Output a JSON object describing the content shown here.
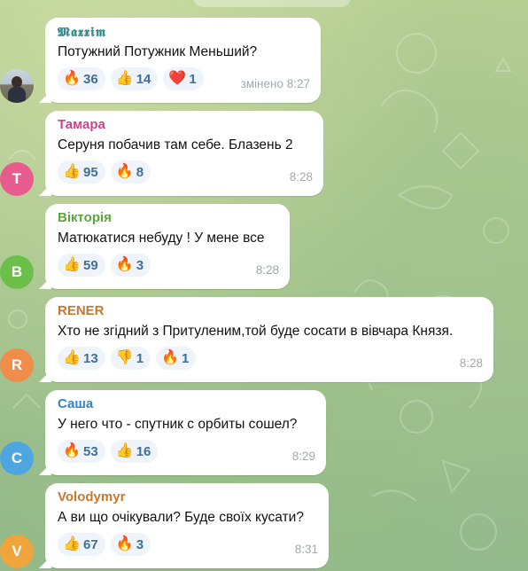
{
  "messages": [
    {
      "sender": "𝕸𝖆𝖝𝖝𝖎𝖒",
      "sender_color": "#3a8a8e",
      "text": "Потужний Потужник Меньший?",
      "reactions": [
        {
          "emoji": "🔥",
          "count": "36"
        },
        {
          "emoji": "👍",
          "count": "14"
        },
        {
          "emoji": "❤️",
          "count": "1"
        }
      ],
      "time": "змінено 8:27",
      "avatar": {
        "type": "photo"
      }
    },
    {
      "sender": "Тамара",
      "sender_color": "#c3468f",
      "text": "Серуня побачив там себе.  Блазень 2",
      "reactions": [
        {
          "emoji": "👍",
          "count": "95"
        },
        {
          "emoji": "🔥",
          "count": "8"
        }
      ],
      "time": "8:28",
      "avatar": {
        "type": "letter",
        "letter": "T",
        "color": "#e85c8d"
      }
    },
    {
      "sender": "Вікторія",
      "sender_color": "#5aa63a",
      "text": "Матюкатися небуду ! У мене все",
      "reactions": [
        {
          "emoji": "👍",
          "count": "59"
        },
        {
          "emoji": "🔥",
          "count": "3"
        }
      ],
      "time": "8:28",
      "avatar": {
        "type": "letter",
        "letter": "B",
        "color": "#6cc04a"
      }
    },
    {
      "sender": "RENER",
      "sender_color": "#c8772f",
      "text": "Хто не згідний з Притуленим,той буде сосати в вівчара Князя.",
      "reactions": [
        {
          "emoji": "👍",
          "count": "13"
        },
        {
          "emoji": "👎",
          "count": "1"
        },
        {
          "emoji": "🔥",
          "count": "1"
        }
      ],
      "time": "8:28",
      "avatar": {
        "type": "letter",
        "letter": "R",
        "color": "#f08d4a"
      }
    },
    {
      "sender": "Саша",
      "sender_color": "#2f86c6",
      "text": "У него что - спутник с орбиты сошел?",
      "reactions": [
        {
          "emoji": "🔥",
          "count": "53"
        },
        {
          "emoji": "👍",
          "count": "16"
        }
      ],
      "time": "8:29",
      "avatar": {
        "type": "letter",
        "letter": "C",
        "color": "#4ea6e0"
      }
    },
    {
      "sender": "Volodymyr",
      "sender_color": "#c8772f",
      "text": "А ви що очікували? Буде своїх кусати?",
      "reactions": [
        {
          "emoji": "👍",
          "count": "67"
        },
        {
          "emoji": "🔥",
          "count": "3"
        }
      ],
      "time": "8:31",
      "avatar": {
        "type": "letter",
        "letter": "V",
        "color": "#f0a53c"
      }
    }
  ]
}
